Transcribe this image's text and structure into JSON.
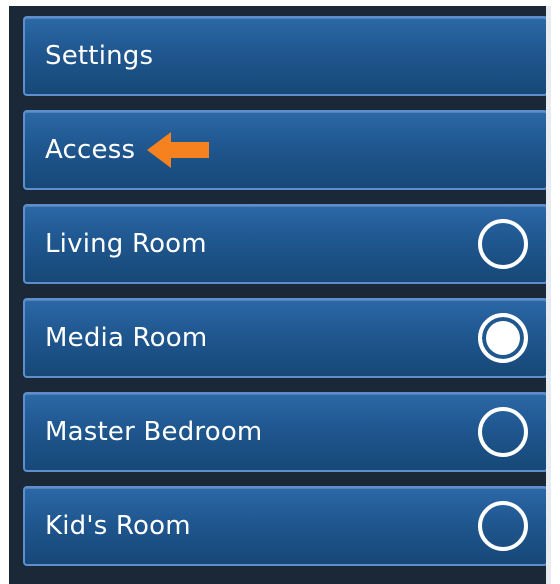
{
  "menu": {
    "items": [
      {
        "label": "Settings",
        "has_radio": false
      },
      {
        "label": "Access",
        "has_radio": false,
        "annotation_icon": "arrow-left-icon",
        "annotation_color": "#f5821f"
      },
      {
        "label": "Living Room",
        "has_radio": true,
        "selected": false
      },
      {
        "label": "Media Room",
        "has_radio": true,
        "selected": true
      },
      {
        "label": "Master Bedroom",
        "has_radio": true,
        "selected": false
      },
      {
        "label": "Kid's Room",
        "has_radio": true,
        "selected": false
      }
    ]
  },
  "colors": {
    "panel_background": "#1b2838",
    "button_border": "#5d8fcf",
    "button_fill": "#1f578f",
    "annotation_arrow": "#f5821f"
  }
}
